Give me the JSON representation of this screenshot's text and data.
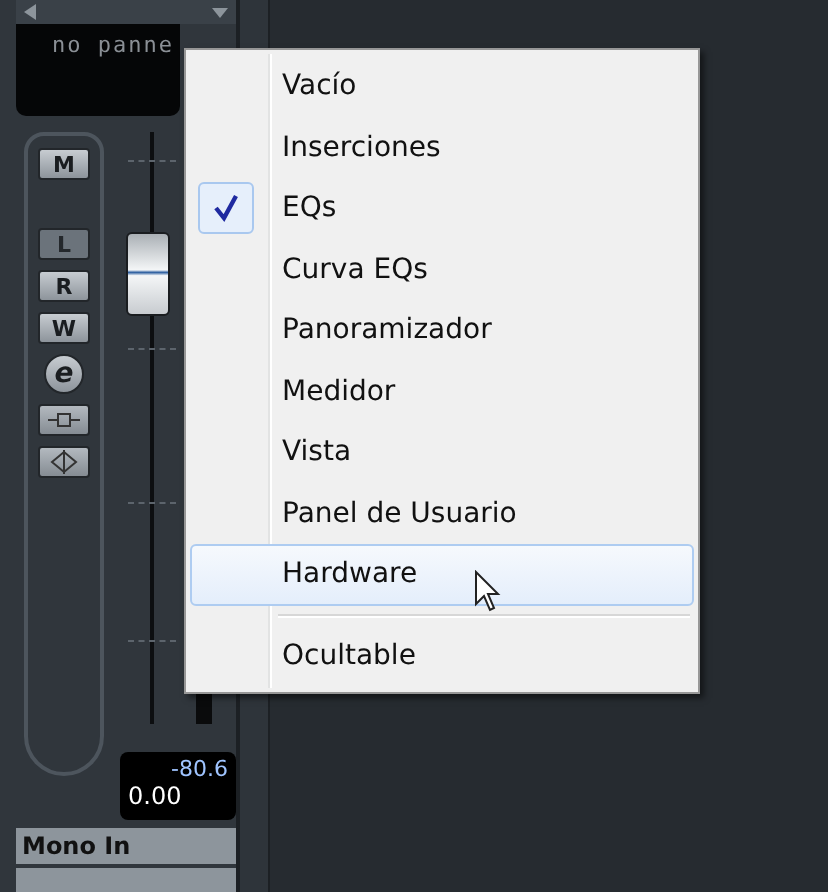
{
  "channel_strip": {
    "display": {
      "text": "no panne"
    },
    "buttons": [
      {
        "kind": "square",
        "label": "M",
        "disabled": false
      },
      {
        "kind": "square",
        "label": "L",
        "disabled": true
      },
      {
        "kind": "square",
        "label": "R",
        "disabled": false
      },
      {
        "kind": "square",
        "label": "W",
        "disabled": false
      },
      {
        "kind": "round",
        "label": "e",
        "disabled": false
      }
    ],
    "fader": {
      "level": 0.76
    },
    "readout": {
      "peak": "-80.6",
      "volume": "0.00"
    },
    "name": "Mono In"
  },
  "context_menu": {
    "items": [
      {
        "kind": "item",
        "label": "Vacío",
        "checked": false,
        "highlighted": false
      },
      {
        "kind": "item",
        "label": "Inserciones",
        "checked": false,
        "highlighted": false
      },
      {
        "kind": "item",
        "label": "EQs",
        "checked": true,
        "highlighted": false
      },
      {
        "kind": "item",
        "label": "Curva EQs",
        "checked": false,
        "highlighted": false
      },
      {
        "kind": "item",
        "label": "Panoramizador",
        "checked": false,
        "highlighted": false
      },
      {
        "kind": "item",
        "label": "Medidor",
        "checked": false,
        "highlighted": false
      },
      {
        "kind": "item",
        "label": "Vista",
        "checked": false,
        "highlighted": false
      },
      {
        "kind": "item",
        "label": "Panel de Usuario",
        "checked": false,
        "highlighted": false
      },
      {
        "kind": "item",
        "label": "Hardware",
        "checked": false,
        "highlighted": true
      },
      {
        "kind": "separator"
      },
      {
        "kind": "item",
        "label": "Ocultable",
        "checked": false,
        "highlighted": false
      }
    ]
  }
}
